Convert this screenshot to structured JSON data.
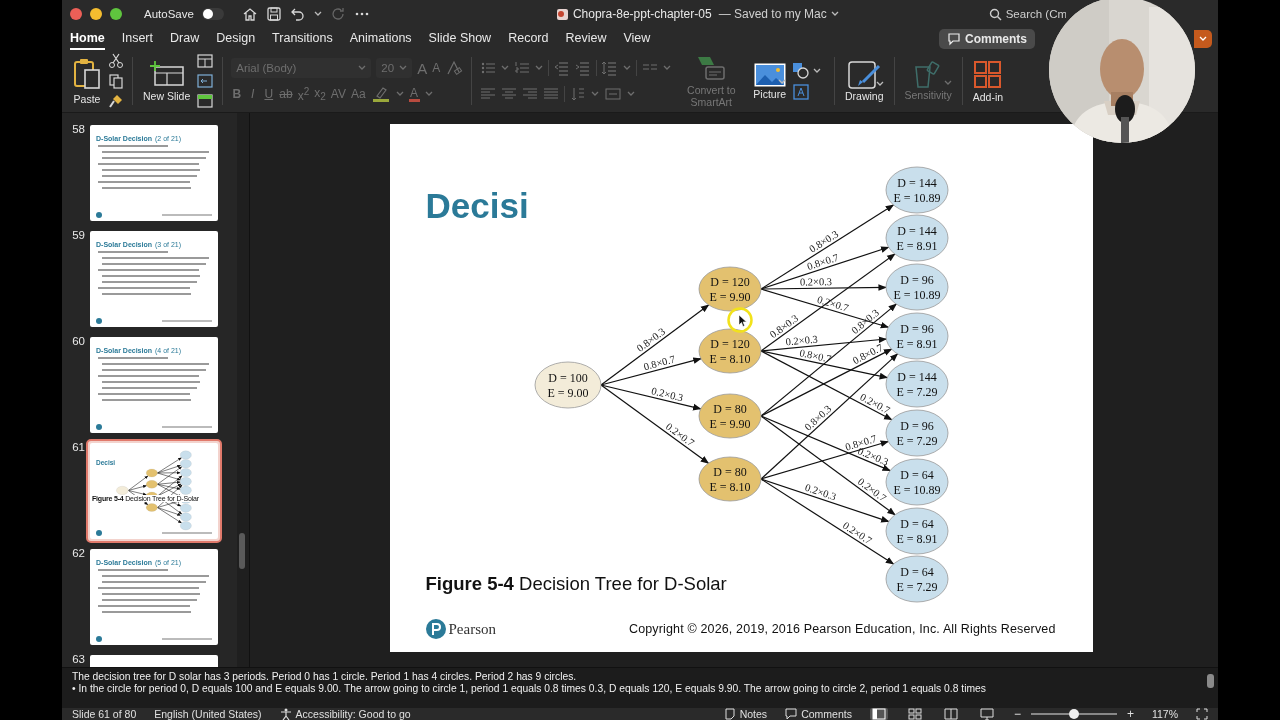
{
  "window": {
    "title": "Chopra-8e-ppt-chapter-05",
    "save_status": "— Saved to my Mac",
    "autosave": {
      "label": "AutoSave",
      "on": false
    },
    "search": {
      "placeholder": "Search (Cm"
    }
  },
  "tabs": [
    {
      "label": "Home",
      "selected": true
    },
    {
      "label": "Insert",
      "selected": false
    },
    {
      "label": "Draw",
      "selected": false
    },
    {
      "label": "Design",
      "selected": false
    },
    {
      "label": "Transitions",
      "selected": false
    },
    {
      "label": "Animations",
      "selected": false
    },
    {
      "label": "Slide Show",
      "selected": false
    },
    {
      "label": "Record",
      "selected": false
    },
    {
      "label": "Review",
      "selected": false
    },
    {
      "label": "View",
      "selected": false
    }
  ],
  "header_buttons": {
    "comments": "Comments"
  },
  "ribbon": {
    "paste": "Paste",
    "new_slide": "New Slide",
    "font": {
      "name": "Arial (Body)",
      "size": "20",
      "disabled": true,
      "size_buttons": [
        "A",
        "A"
      ],
      "format_buttons": [
        {
          "kind": "bold",
          "label": "B"
        },
        {
          "kind": "italic",
          "label": "I"
        },
        {
          "kind": "underline",
          "label": "U"
        },
        {
          "kind": "strike",
          "label": "ab"
        },
        {
          "kind": "plain",
          "label": "x$^{2}$"
        },
        {
          "kind": "plain",
          "label": "x$_{2}$"
        },
        {
          "kind": "plain",
          "label": "AV"
        },
        {
          "kind": "plain",
          "label": "Aa"
        }
      ],
      "font_color": "A"
    },
    "paragraph": {
      "disabled": true
    },
    "commands": [
      {
        "kind": "smartart",
        "label": "Convert to SmartArt",
        "disabled": true
      },
      {
        "kind": "picture",
        "label": "Picture",
        "disabled": false
      },
      {
        "kind": "drawing",
        "label": "Drawing",
        "disabled": false
      },
      {
        "kind": "sensitivity",
        "label": "Sensitivity",
        "disabled": true
      },
      {
        "kind": "addins",
        "label": "Add-in",
        "disabled": false
      }
    ]
  },
  "thumbnails": [
    {
      "number": "58",
      "kind": "text",
      "title": "D-Solar Decision",
      "subtitle": "(2 of 21)",
      "selected": false
    },
    {
      "number": "59",
      "kind": "text",
      "title": "D-Solar Decision",
      "subtitle": "(3 of 21)",
      "selected": false
    },
    {
      "number": "60",
      "kind": "text",
      "title": "D-Solar Decision",
      "subtitle": "(4 of 21)",
      "selected": false
    },
    {
      "number": "61",
      "kind": "figure",
      "title": "Decisi",
      "caption": "**Figure 5-4** Decision Tree for D-Solar",
      "selected": true
    },
    {
      "number": "62",
      "kind": "text",
      "title": "D-Solar Decision",
      "subtitle": "(5 of 21)",
      "selected": false
    },
    {
      "number": "63",
      "kind": "text",
      "selected": false
    }
  ],
  "slide": {
    "title": "Decisi",
    "caption": "**Figure 5-4** Decision Tree for D-Solar",
    "logo": "Pearson",
    "copyright": "Copyright © 2026, 2019, 2016 Pearson Education, Inc. All Rights Reserved",
    "pointer_highlight": true,
    "tree": {
      "periods": [
        {
          "color": "#f3ecd9",
          "nodes": [
            {
              "d": "D = 100",
              "e": "E = 9.00",
              "branches": [
                "0.8×0.3",
                "0.8×0.7",
                "0.2×0.3",
                "0.2×0.7"
              ]
            }
          ]
        },
        {
          "color": "#e3c16f",
          "nodes": [
            {
              "d": "D = 120",
              "e": "E = 9.90",
              "branches": [
                "0.8×0.3",
                "0.8×0.7",
                "0.2×0.3",
                "0.2×0.7"
              ]
            },
            {
              "d": "D = 120",
              "e": "E = 8.10",
              "branches": [
                "0.8×0.3",
                "0.8×0.7",
                "0.2×0.3",
                "0.2×0.7"
              ]
            },
            {
              "d": "D = 80",
              "e": "E = 9.90",
              "branches": [
                "0.8×0.3",
                "0.8×0.7",
                "0.2×0.3",
                "0.2×0.7"
              ]
            },
            {
              "d": "D = 80",
              "e": "E = 8.10",
              "branches": [
                "0.8×0.3",
                "0.8×0.7",
                "0.2×0.3",
                "0.2×0.7"
              ]
            }
          ]
        },
        {
          "color": "#c9dfec",
          "nodes": [
            {
              "d": "D = 144",
              "e": "E = 10.89"
            },
            {
              "d": "D = 144",
              "e": "E = 8.91"
            },
            {
              "d": "D = 96",
              "e": "E = 10.89"
            },
            {
              "d": "D = 96",
              "e": "E = 8.91"
            },
            {
              "d": "D = 144",
              "e": "E = 7.29"
            },
            {
              "d": "D = 96",
              "e": "E = 7.29"
            },
            {
              "d": "D = 64",
              "e": "E = 10.89"
            },
            {
              "d": "D = 64",
              "e": "E = 8.91"
            },
            {
              "d": "D = 64",
              "e": "E = 7.29"
            }
          ]
        }
      ]
    }
  },
  "webcam": {
    "kind": "picture"
  },
  "notes": [
    "The decision tree for D solar has 3 periods. Period 0 has 1 circle. Period 1 has 4 circles. Period 2 has 9 circles.",
    "• In the circle for period 0, D equals 100 and E equals 9.00. The arrow going to circle 1, period 1 equals 0.8 times 0.3, D equals 120, E equals 9.90. The arrow going to circle 2, period 1 equals 0.8 times"
  ],
  "status_bar": {
    "slide": "Slide 61 of 80",
    "language": "English (United States)",
    "accessibility": "Accessibility: Good to go",
    "notes": "Notes",
    "comments": "Comments",
    "views": [
      {
        "kind": "normal",
        "selected": true
      },
      {
        "kind": "sorter",
        "selected": false
      },
      {
        "kind": "reading",
        "selected": false
      },
      {
        "kind": "slideshow",
        "selected": false
      }
    ],
    "zoom_out": "−",
    "zoom_in": "+",
    "zoom": {
      "level": 0.5
    },
    "zoom_reading": "117%"
  }
}
